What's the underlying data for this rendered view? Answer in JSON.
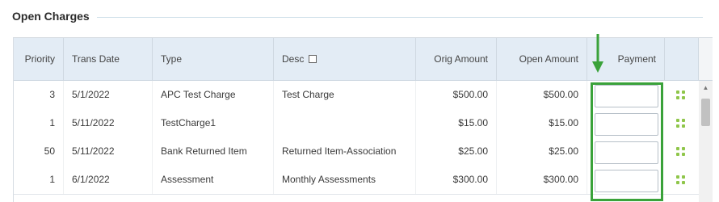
{
  "section": {
    "title": "Open Charges"
  },
  "columns": {
    "priority": "Priority",
    "trans_date": "Trans Date",
    "type": "Type",
    "desc": "Desc",
    "orig_amount": "Orig Amount",
    "open_amount": "Open Amount",
    "payment": "Payment"
  },
  "rows": [
    {
      "priority": "3",
      "trans_date": "5/1/2022",
      "type": "APC Test Charge",
      "desc": "Test Charge",
      "orig_amount": "$500.00",
      "open_amount": "$500.00",
      "payment": ""
    },
    {
      "priority": "1",
      "trans_date": "5/11/2022",
      "type": "TestCharge1",
      "desc": "",
      "orig_amount": "$15.00",
      "open_amount": "$15.00",
      "payment": ""
    },
    {
      "priority": "50",
      "trans_date": "5/11/2022",
      "type": "Bank Returned Item",
      "desc": "Returned Item-Association",
      "orig_amount": "$25.00",
      "open_amount": "$25.00",
      "payment": ""
    },
    {
      "priority": "1",
      "trans_date": "6/1/2022",
      "type": "Assessment",
      "desc": "Monthly Assessments",
      "orig_amount": "$300.00",
      "open_amount": "$300.00",
      "payment": ""
    }
  ],
  "icons": {
    "drag": "drag-handle-icon",
    "arrow": "arrow-down-icon",
    "checkbox": "checkbox-icon"
  },
  "colors": {
    "header_bg": "#e3ecf5",
    "highlight": "#3aa23a",
    "drag": "#8fc64a"
  }
}
